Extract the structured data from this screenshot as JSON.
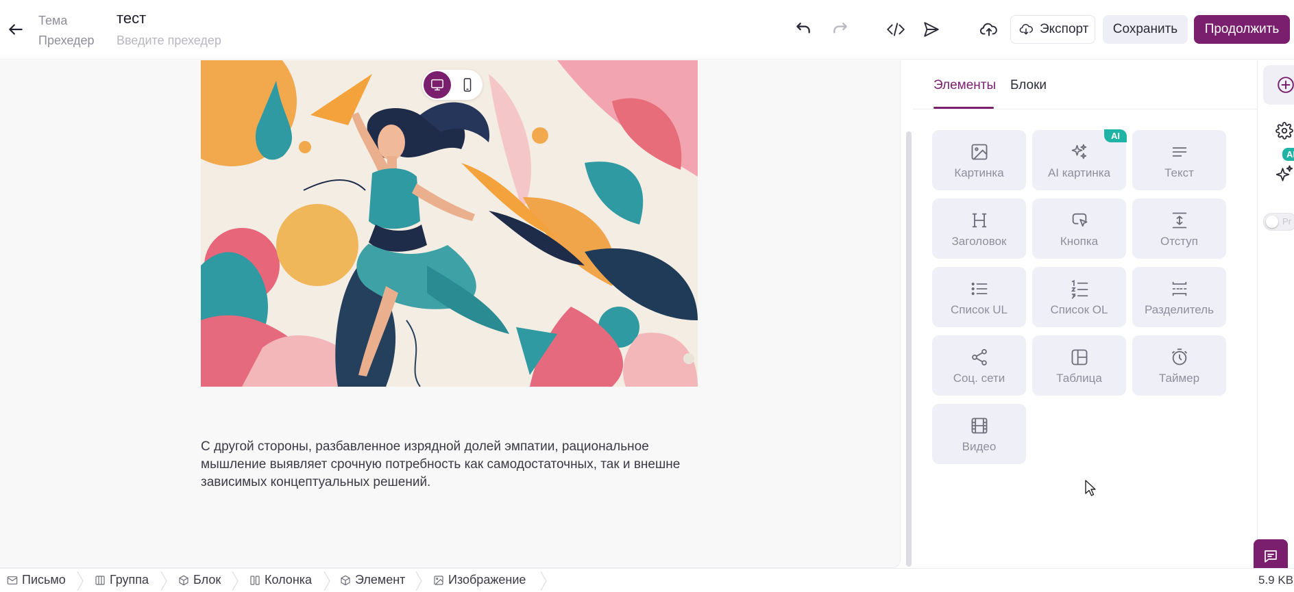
{
  "header": {
    "subject_label": "Тема",
    "preheader_label": "Прехедер",
    "subject_value": "тест",
    "preheader_placeholder": "Введите прехедер",
    "export_label": "Экспорт",
    "save_label": "Сохранить",
    "continue_label": "Продолжить"
  },
  "canvas": {
    "body_text": "С другой стороны, разбавленное изрядной долей эмпатии, рациональное мышление выявляет срочную потребность как самодостаточных, так и внешне зависимых концептуальных решений."
  },
  "panel": {
    "tabs": [
      {
        "label": "Элементы",
        "active": true
      },
      {
        "label": "Блоки",
        "active": false
      }
    ],
    "ai_badge": "AI",
    "tiles": [
      {
        "label": "Картинка",
        "icon": "image-icon"
      },
      {
        "label": "AI картинка",
        "icon": "sparkles-icon"
      },
      {
        "label": "Текст",
        "icon": "text-icon"
      },
      {
        "label": "Заголовок",
        "icon": "heading-icon"
      },
      {
        "label": "Кнопка",
        "icon": "button-cursor-icon"
      },
      {
        "label": "Отступ",
        "icon": "spacer-icon"
      },
      {
        "label": "Список UL",
        "icon": "list-ul-icon"
      },
      {
        "label": "Список OL",
        "icon": "list-ol-icon"
      },
      {
        "label": "Разделитель",
        "icon": "divider-icon"
      },
      {
        "label": "Соц. сети",
        "icon": "share-icon"
      },
      {
        "label": "Таблица",
        "icon": "table-icon"
      },
      {
        "label": "Таймер",
        "icon": "timer-icon"
      },
      {
        "label": "Видео",
        "icon": "video-icon"
      }
    ]
  },
  "strip": {
    "ai_badge": "AI",
    "toggle_label": "Pr"
  },
  "breadcrumb": {
    "items": [
      {
        "label": "Письмо",
        "icon": "mail-icon"
      },
      {
        "label": "Группа",
        "icon": "columns-group-icon"
      },
      {
        "label": "Блок",
        "icon": "cube-icon"
      },
      {
        "label": "Колонка",
        "icon": "column-icon"
      },
      {
        "label": "Элемент",
        "icon": "cube-icon"
      },
      {
        "label": "Изображение",
        "icon": "image-icon"
      }
    ],
    "size": "5.9 KB"
  },
  "colors": {
    "brand": "#7a1f6e",
    "ai_badge": "#1fb3a5",
    "tile_bg": "#eff0f7"
  }
}
